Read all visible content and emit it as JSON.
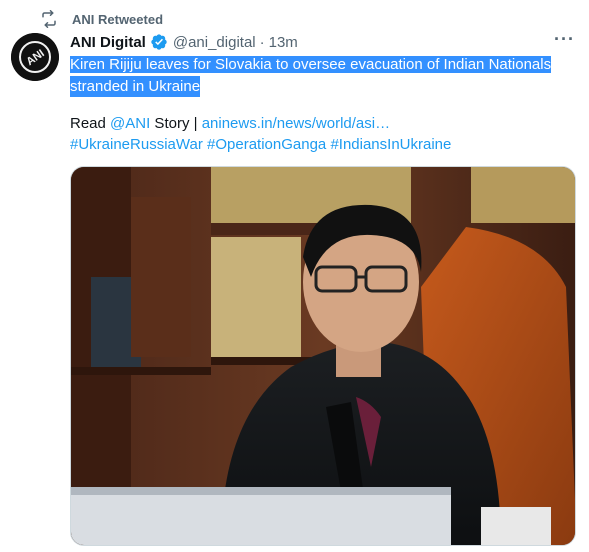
{
  "retweet": {
    "label": "ANI Retweeted",
    "icon": "retweet-icon"
  },
  "author": {
    "name": "ANI Digital",
    "handle": "@ani_digital",
    "separator": "·",
    "time": "13m",
    "avatar_text": "ANI",
    "verified_icon": "verified-badge-icon"
  },
  "more_label": "···",
  "tweet": {
    "headline_line1": "Kiren Rijiju leaves for Slovakia to oversee evacuation of Indian Nationals",
    "headline_line2": "stranded in Ukraine",
    "read_prefix": "Read ",
    "read_mention": "@ANI",
    "read_middle": " Story | ",
    "read_link": "aninews.in/news/world/asi…",
    "hashtags": [
      "#UkraineRussiaWar",
      "#OperationGanga",
      "#IndiansInUkraine"
    ]
  },
  "colors": {
    "link": "#1d9bf0",
    "selection": "#3390ff",
    "muted": "#536471"
  }
}
